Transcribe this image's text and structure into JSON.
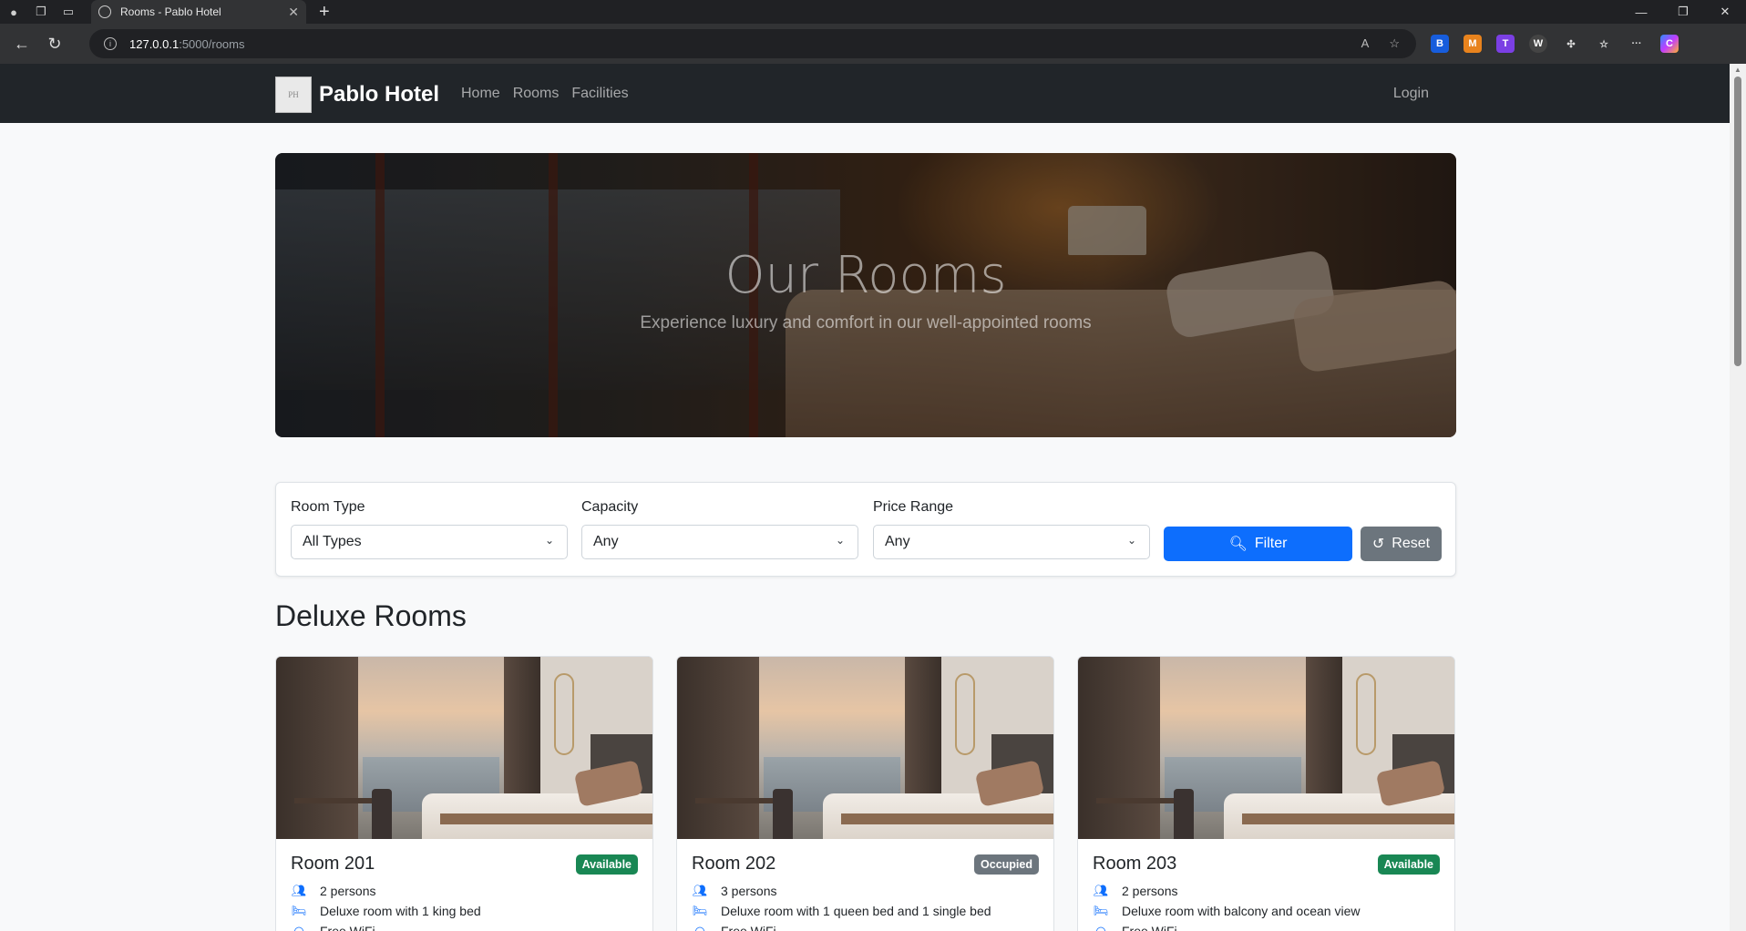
{
  "browser": {
    "tab_title": "Rooms - Pablo Hotel",
    "url_host": "127.0.0.1",
    "url_path": ":5000/rooms"
  },
  "navbar": {
    "logo_text": "PH",
    "brand": "Pablo Hotel",
    "links": [
      "Home",
      "Rooms",
      "Facilities"
    ],
    "login": "Login"
  },
  "hero": {
    "title": "Our Rooms",
    "subtitle": "Experience luxury and comfort in our well-appointed rooms"
  },
  "filter": {
    "room_type": {
      "label": "Room Type",
      "value": "All Types"
    },
    "capacity": {
      "label": "Capacity",
      "value": "Any"
    },
    "price_range": {
      "label": "Price Range",
      "value": "Any"
    },
    "filter_button": "Filter",
    "reset_button": "Reset"
  },
  "section": {
    "title": "Deluxe Rooms"
  },
  "rooms": [
    {
      "name": "Room 201",
      "status": "Available",
      "capacity": "2 persons",
      "description": "Deluxe room with 1 king bed",
      "amenity": "Free WiFi"
    },
    {
      "name": "Room 202",
      "status": "Occupied",
      "capacity": "3 persons",
      "description": "Deluxe room with 1 queen bed and 1 single bed",
      "amenity": "Free WiFi"
    },
    {
      "name": "Room 203",
      "status": "Available",
      "capacity": "2 persons",
      "description": "Deluxe room with balcony and ocean view",
      "amenity": "Free WiFi"
    }
  ],
  "colors": {
    "primary": "#0d6efd",
    "success": "#198754",
    "secondary": "#6c757d",
    "navbar": "#212529"
  }
}
